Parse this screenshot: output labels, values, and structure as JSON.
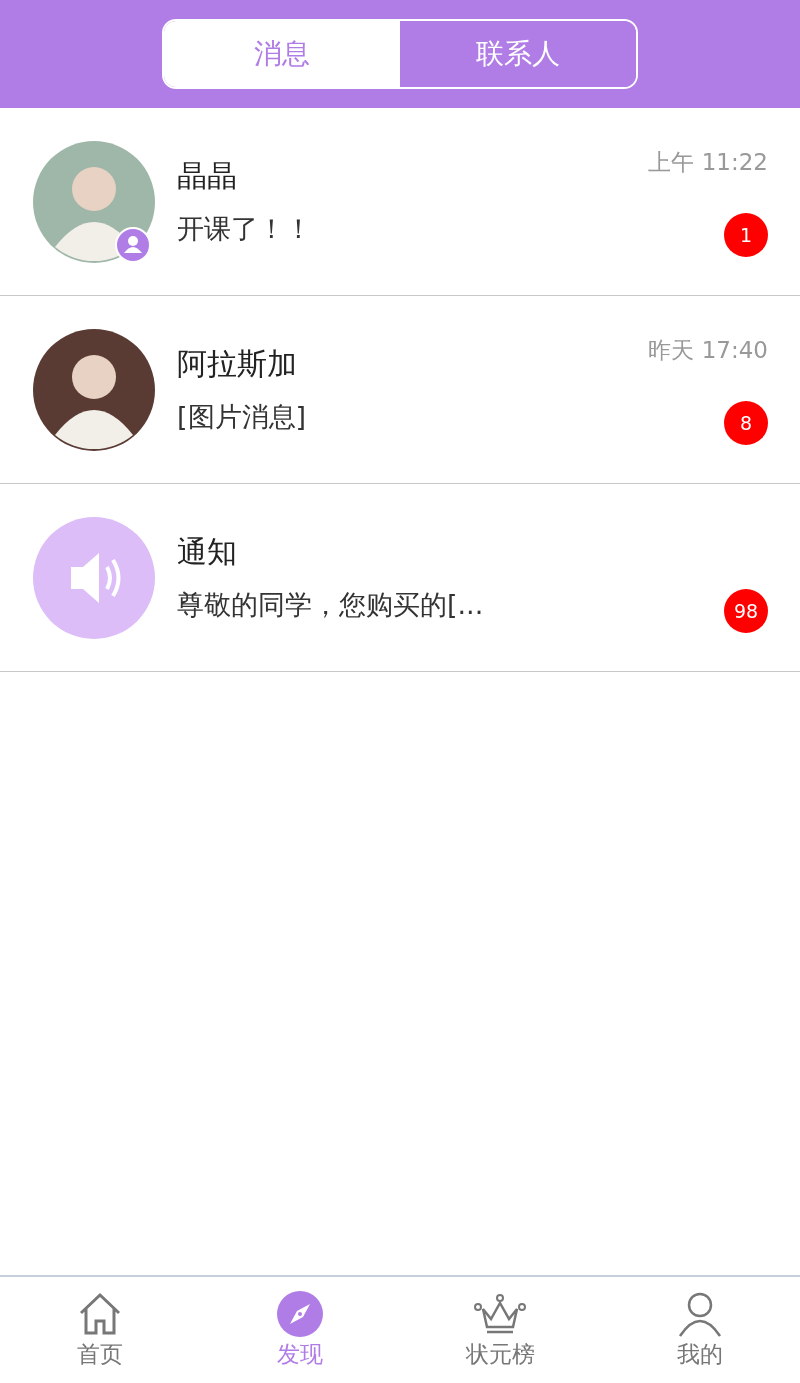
{
  "segments": [
    {
      "label": "消息",
      "selected": true
    },
    {
      "label": "联系人",
      "selected": false
    }
  ],
  "conversations": [
    {
      "kind": "person",
      "name": "晶晶",
      "preview": "开课了！！",
      "time": "上午 11:22",
      "unread": "1",
      "verified": true
    },
    {
      "kind": "person",
      "name": "阿拉斯加",
      "preview": "[图片消息]",
      "time": "昨天 17:40",
      "unread": "8",
      "verified": false
    },
    {
      "kind": "notice",
      "name": "通知",
      "preview": "尊敬的同学，您购买的[...",
      "unread": "98",
      "verified": false
    }
  ],
  "nav": [
    {
      "kind": "home",
      "label": "首页",
      "selected": false
    },
    {
      "kind": "compass",
      "label": "发现",
      "selected": true
    },
    {
      "kind": "crown",
      "label": "状元榜",
      "selected": false
    },
    {
      "kind": "person",
      "label": "我的",
      "selected": false
    }
  ]
}
